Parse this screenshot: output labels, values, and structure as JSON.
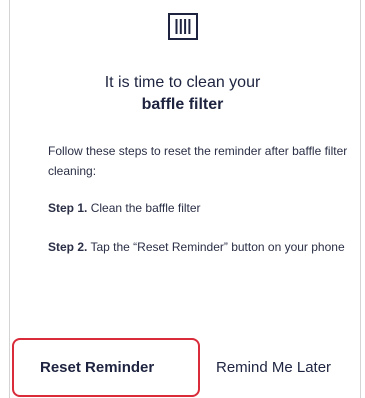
{
  "header": {
    "icon": "baffle-filter-icon"
  },
  "title": {
    "line1": "It is time to clean your",
    "line2": "baffle filter"
  },
  "instructions": {
    "intro": "Follow these steps to reset the reminder after baffle filter cleaning:",
    "step1_label": "Step 1.",
    "step1_text": " Clean the baffle filter",
    "step2_label": "Step 2.",
    "step2_text": " Tap the “Reset Reminder” button on your phone"
  },
  "actions": {
    "reset_label": "Reset Reminder",
    "later_label": "Remind Me Later"
  },
  "colors": {
    "text": "#1e2440",
    "highlight": "#d92b3a"
  }
}
